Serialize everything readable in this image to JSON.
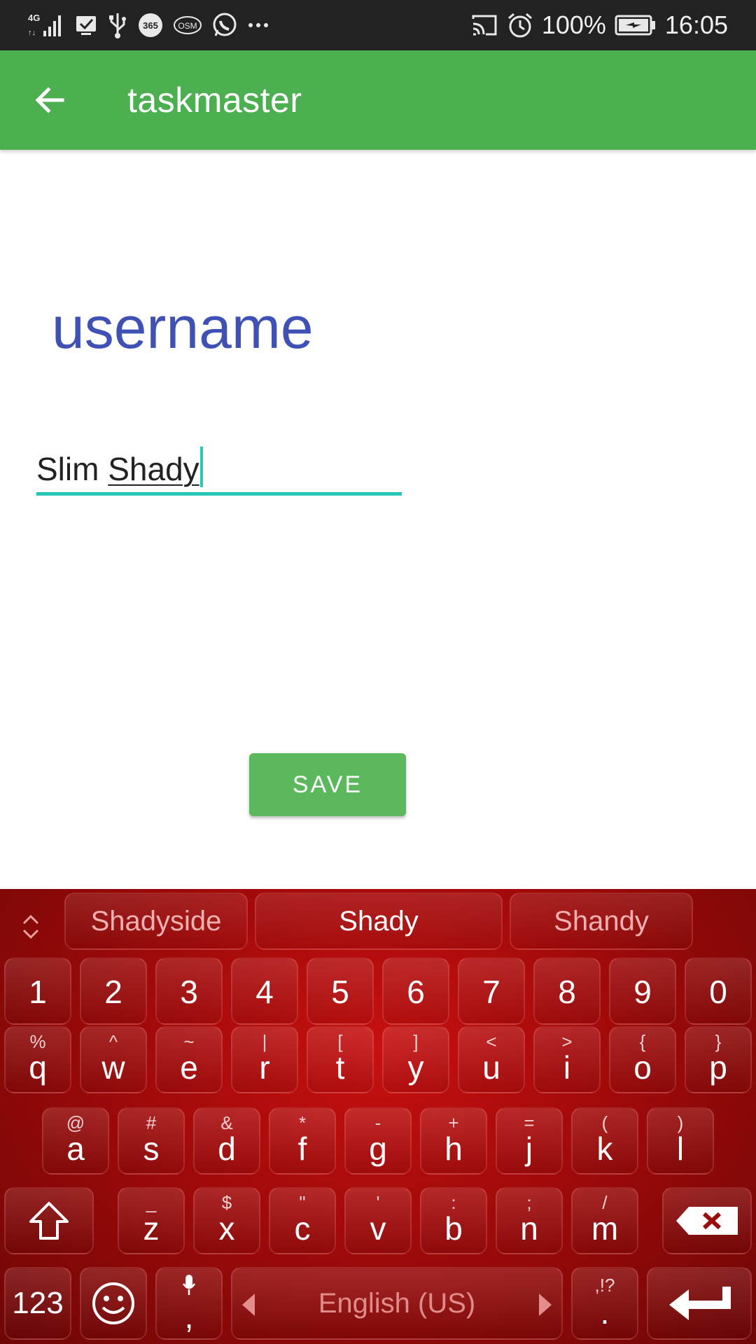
{
  "status_bar": {
    "network": "4G",
    "icons_left": [
      "signal-icon",
      "checkbox-notification-icon",
      "usb-icon",
      "app-365-icon",
      "osm-icon",
      "whatsapp-icon",
      "more-icon"
    ],
    "icons_right": [
      "cast-icon",
      "alarm-icon",
      "battery-charging-icon"
    ],
    "battery": "100%",
    "time": "16:05"
  },
  "app_bar": {
    "title": "taskmaster",
    "back_icon": "arrow-left-icon",
    "color": "#4caf50"
  },
  "content": {
    "heading": "username",
    "input": {
      "text_plain": "Slim ",
      "text_composing": "Shady"
    },
    "save_label": "SAVE"
  },
  "keyboard": {
    "suggestions": [
      "Shadyside",
      "Shady",
      "Shandy"
    ],
    "number_row": [
      "1",
      "2",
      "3",
      "4",
      "5",
      "6",
      "7",
      "8",
      "9",
      "0"
    ],
    "row1": [
      {
        "main": "q",
        "sub": "%"
      },
      {
        "main": "w",
        "sub": "^"
      },
      {
        "main": "e",
        "sub": "~"
      },
      {
        "main": "r",
        "sub": "|"
      },
      {
        "main": "t",
        "sub": "["
      },
      {
        "main": "y",
        "sub": "]"
      },
      {
        "main": "u",
        "sub": "<"
      },
      {
        "main": "i",
        "sub": ">"
      },
      {
        "main": "o",
        "sub": "{"
      },
      {
        "main": "p",
        "sub": "}"
      }
    ],
    "row2": [
      {
        "main": "a",
        "sub": "@"
      },
      {
        "main": "s",
        "sub": "#"
      },
      {
        "main": "d",
        "sub": "&"
      },
      {
        "main": "f",
        "sub": "*"
      },
      {
        "main": "g",
        "sub": "-"
      },
      {
        "main": "h",
        "sub": "+"
      },
      {
        "main": "j",
        "sub": "="
      },
      {
        "main": "k",
        "sub": "("
      },
      {
        "main": "l",
        "sub": ")"
      }
    ],
    "row3": [
      {
        "main": "z",
        "sub": "_"
      },
      {
        "main": "x",
        "sub": "$"
      },
      {
        "main": "c",
        "sub": "\""
      },
      {
        "main": "v",
        "sub": "'"
      },
      {
        "main": "b",
        "sub": ":"
      },
      {
        "main": "n",
        "sub": ";"
      },
      {
        "main": "m",
        "sub": "/"
      }
    ],
    "numbers_key": "123",
    "comma_key": ",",
    "space_label": "English (US)",
    "period_key": ".",
    "period_sub": ",!?",
    "theme_color": "#b30d0d"
  }
}
